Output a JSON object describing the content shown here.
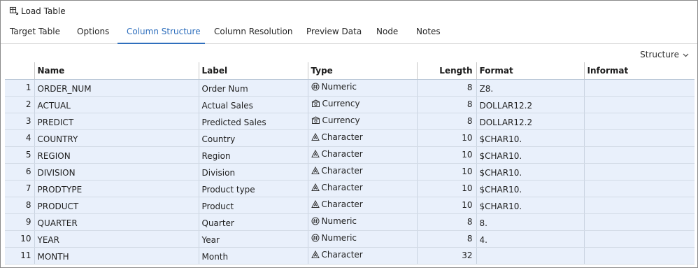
{
  "window": {
    "title": "Load Table",
    "icon": "load-table-icon"
  },
  "tabs": [
    {
      "label": "Target Table",
      "active": false
    },
    {
      "label": "Options",
      "active": false
    },
    {
      "label": "Column Structure",
      "active": true
    },
    {
      "label": "Column Resolution",
      "active": false
    },
    {
      "label": "Preview Data",
      "active": false
    },
    {
      "label": "Node",
      "active": false
    },
    {
      "label": "Notes",
      "active": false
    }
  ],
  "structure_menu": {
    "label": "Structure",
    "icon": "chevron-down-icon"
  },
  "table": {
    "headers": [
      "",
      "Name",
      "Label",
      "Type",
      "Length",
      "Format",
      "Informat"
    ],
    "rows": [
      {
        "num": "1",
        "name": "ORDER_NUM",
        "label": "Order Num",
        "type": "Numeric",
        "type_icon": "numeric-icon",
        "length": "8",
        "format": "Z8.",
        "informat": ""
      },
      {
        "num": "2",
        "name": "ACTUAL",
        "label": "Actual Sales",
        "type": "Currency",
        "type_icon": "currency-icon",
        "length": "8",
        "format": "DOLLAR12.2",
        "informat": ""
      },
      {
        "num": "3",
        "name": "PREDICT",
        "label": "Predicted Sales",
        "type": "Currency",
        "type_icon": "currency-icon",
        "length": "8",
        "format": "DOLLAR12.2",
        "informat": ""
      },
      {
        "num": "4",
        "name": "COUNTRY",
        "label": "Country",
        "type": "Character",
        "type_icon": "character-icon",
        "length": "10",
        "format": "$CHAR10.",
        "informat": ""
      },
      {
        "num": "5",
        "name": "REGION",
        "label": "Region",
        "type": "Character",
        "type_icon": "character-icon",
        "length": "10",
        "format": "$CHAR10.",
        "informat": ""
      },
      {
        "num": "6",
        "name": "DIVISION",
        "label": "Division",
        "type": "Character",
        "type_icon": "character-icon",
        "length": "10",
        "format": "$CHAR10.",
        "informat": ""
      },
      {
        "num": "7",
        "name": "PRODTYPE",
        "label": "Product type",
        "type": "Character",
        "type_icon": "character-icon",
        "length": "10",
        "format": "$CHAR10.",
        "informat": ""
      },
      {
        "num": "8",
        "name": "PRODUCT",
        "label": "Product",
        "type": "Character",
        "type_icon": "character-icon",
        "length": "10",
        "format": "$CHAR10.",
        "informat": ""
      },
      {
        "num": "9",
        "name": "QUARTER",
        "label": "Quarter",
        "type": "Numeric",
        "type_icon": "numeric-icon",
        "length": "8",
        "format": "8.",
        "informat": ""
      },
      {
        "num": "10",
        "name": "YEAR",
        "label": "Year",
        "type": "Numeric",
        "type_icon": "numeric-icon",
        "length": "8",
        "format": "4.",
        "informat": ""
      },
      {
        "num": "11",
        "name": "MONTH",
        "label": "Month",
        "type": "Character",
        "type_icon": "character-icon",
        "length": "32",
        "format": "",
        "informat": ""
      }
    ]
  }
}
